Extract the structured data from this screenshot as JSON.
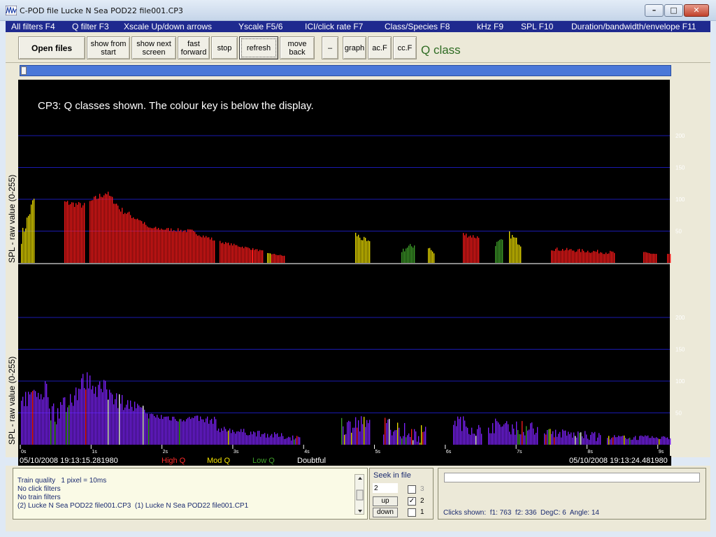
{
  "window": {
    "title": "C-POD file  Lucke N Sea POD22 file001.CP3",
    "caption_min": "–",
    "caption_max": "□",
    "caption_close": "✕"
  },
  "menu": [
    "All filters F4",
    "Q filter F3",
    "Xscale Up/down arrows",
    "Yscale F5/6",
    "ICI/click rate F7",
    "Class/Species F8",
    "kHz F9",
    "SPL F10",
    "Duration/bandwidth/envelope F11"
  ],
  "toolbar": {
    "open_files": "Open files",
    "show_from_start_1": "show from",
    "show_from_start_2": "start",
    "show_next_1": "show next",
    "show_next_2": "screen",
    "fast_forward_1": "fast",
    "fast_forward_2": "forward",
    "stop": "stop",
    "refresh": "refresh",
    "move_back_1": "move",
    "move_back_2": "back",
    "minus": "–",
    "graph": "graph",
    "acf": "ac.F",
    "ccf": "cc.F",
    "qclass": "Q class"
  },
  "display": {
    "message": "CP3: Q classes shown.   The colour key is below the display.",
    "y_axis_label": "SPL - raw value (0-255)",
    "y_ticks": [
      50,
      100,
      150,
      200
    ],
    "y_max": 255,
    "x_ticks": [
      "0s",
      "1s",
      "2s",
      "3s",
      "4s",
      "5s",
      "6s",
      "7s",
      "8s",
      "9s"
    ],
    "colors": {
      "high_q": "#ff1a1a",
      "mod_q": "#f0e000",
      "low_q": "#3fa02a",
      "doubtful": "#ffffff",
      "lower_panel": "#7f22ff",
      "grid": "#1a1ab0"
    }
  },
  "status": {
    "start_time": "05/10/2008 19:13:15.281980",
    "high_q": "High Q",
    "mod_q": "Mod Q",
    "low_q": "Low Q",
    "doubtful": "Doubtful",
    "end_time": "05/10/2008 19:13:24.481980"
  },
  "info": {
    "line1": "Train quality   1 pixel = 10ms",
    "line2": "No click filters",
    "line3": "No train filters",
    "line4": "(2) Lucke N Sea POD22 file001.CP3  (1) Lucke N Sea POD22 file001.CP1"
  },
  "seek": {
    "title": "Seek   in file",
    "value": "2",
    "up": "up",
    "down": "down",
    "opt3": "3",
    "opt2": "2",
    "opt1": "1",
    "checked": "✓"
  },
  "stats": {
    "clicks_label": "Clicks shown:",
    "f1": "f1: 763",
    "f2": "f2: 336",
    "degc": "DegC: 6",
    "angle": "Angle: 14"
  }
}
